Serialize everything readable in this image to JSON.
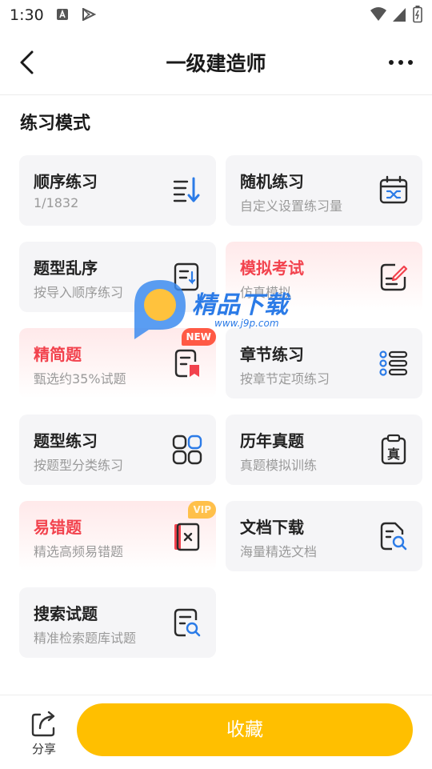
{
  "status_bar": {
    "time": "1:30"
  },
  "header": {
    "title": "一级建造师"
  },
  "section_title": "练习模式",
  "cards": [
    {
      "title": "顺序练习",
      "subtitle": "1/1832",
      "icon": "sort-down-icon"
    },
    {
      "title": "随机练习",
      "subtitle": "自定义设置练习量",
      "icon": "calendar-shuffle-icon"
    },
    {
      "title": "题型乱序",
      "subtitle": "按导入顺序练习",
      "icon": "document-list-icon"
    },
    {
      "title": "模拟考试",
      "subtitle": "仿真模拟",
      "icon": "edit-note-icon"
    },
    {
      "title": "精简题",
      "subtitle": "甄选约35%试题",
      "icon": "document-bookmark-icon",
      "badge": "NEW"
    },
    {
      "title": "章节练习",
      "subtitle": "按章节定项练习",
      "icon": "bullet-list-icon"
    },
    {
      "title": "题型练习",
      "subtitle": "按题型分类练习",
      "icon": "grid-icon"
    },
    {
      "title": "历年真题",
      "subtitle": "真题模拟训练",
      "icon": "clipboard-zhen-icon",
      "icon_text": "真"
    },
    {
      "title": "易错题",
      "subtitle": "精选高频易错题",
      "icon": "error-book-icon",
      "badge": "VIP"
    },
    {
      "title": "文档下载",
      "subtitle": "海量精选文档",
      "icon": "document-search-icon"
    },
    {
      "title": "搜索试题",
      "subtitle": "精准检索题库试题",
      "icon": "search-list-icon"
    }
  ],
  "watermark": {
    "text": "精品下载",
    "url": "www.j9p.com"
  },
  "bottom_bar": {
    "share_label": "分享",
    "favorite_label": "收藏"
  },
  "colors": {
    "accent": "#ffbf00",
    "highlight_text": "#f2424d",
    "card_bg": "#f5f5f7"
  }
}
